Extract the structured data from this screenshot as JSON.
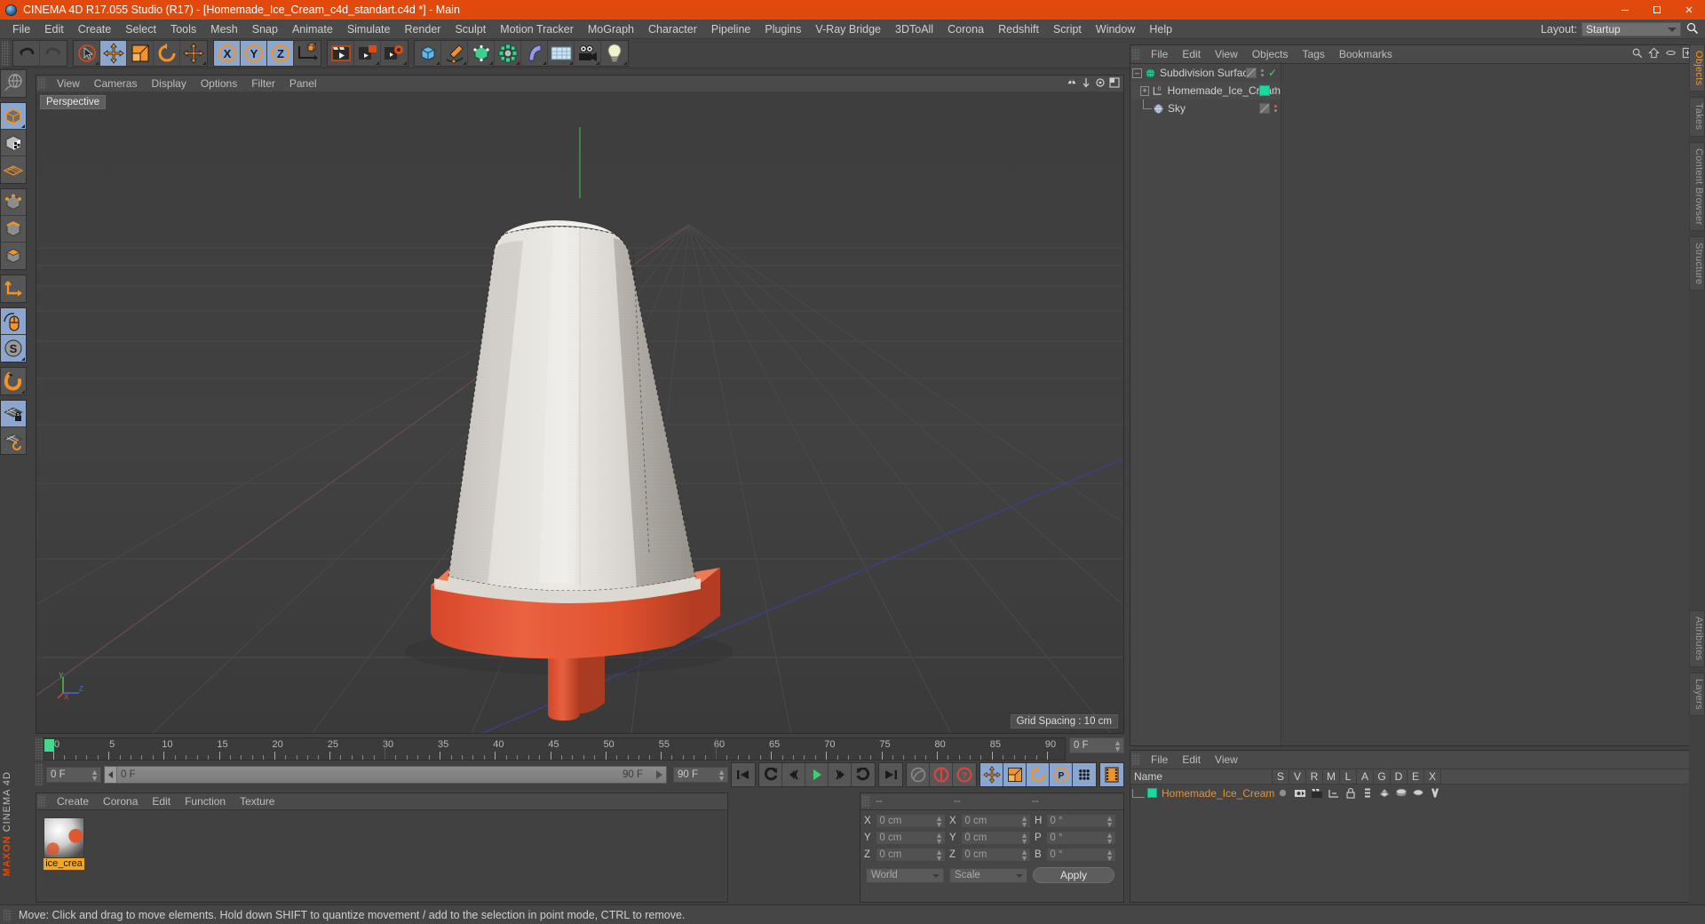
{
  "window": {
    "title": "CINEMA 4D R17.055 Studio (R17) - [Homemade_Ice_Cream_c4d_standart.c4d *] - Main",
    "minimize": "–",
    "maximize": "▢",
    "close": "✕"
  },
  "menubar": {
    "items": [
      "File",
      "Edit",
      "Create",
      "Select",
      "Tools",
      "Mesh",
      "Snap",
      "Animate",
      "Simulate",
      "Render",
      "Sculpt",
      "Motion Tracker",
      "MoGraph",
      "Character",
      "Pipeline",
      "Plugins",
      "V-Ray Bridge",
      "3DToAll",
      "Corona",
      "Redshift",
      "Script",
      "Window",
      "Help"
    ],
    "layout_label": "Layout:",
    "layout_value": "Startup"
  },
  "viewport": {
    "menu": [
      "View",
      "Cameras",
      "Display",
      "Options",
      "Filter",
      "Panel"
    ],
    "view_label": "Perspective",
    "grid_spacing": "Grid Spacing : 10 cm",
    "axis_x": "X",
    "axis_y": "Y",
    "axis_z": "Z"
  },
  "timeline": {
    "ticks": [
      0,
      5,
      10,
      15,
      20,
      25,
      30,
      35,
      40,
      45,
      50,
      55,
      60,
      65,
      70,
      75,
      80,
      85,
      90
    ],
    "current_frame_field": "0 F",
    "frame_end_field": "0 F",
    "scrub_left": "0 F",
    "scrub_right": "90 F",
    "range_end": "90 F",
    "preview_end": "90 F"
  },
  "material_manager": {
    "menu": [
      "Create",
      "Corona",
      "Edit",
      "Function",
      "Texture"
    ],
    "materials": [
      {
        "name": "ice_crea"
      }
    ]
  },
  "coordinates": {
    "header": [
      "--",
      "--",
      "--"
    ],
    "rows": [
      {
        "pos_label": "X",
        "pos_value": "0 cm",
        "size_label": "X",
        "size_value": "0 cm",
        "rot_label": "H",
        "rot_value": "0 °"
      },
      {
        "pos_label": "Y",
        "pos_value": "0 cm",
        "size_label": "Y",
        "size_value": "0 cm",
        "rot_label": "P",
        "rot_value": "0 °"
      },
      {
        "pos_label": "Z",
        "pos_value": "0 cm",
        "size_label": "Z",
        "size_value": "0 cm",
        "rot_label": "B",
        "rot_value": "0 °"
      }
    ],
    "space_select": "World",
    "mode_select": "Scale",
    "apply_label": "Apply"
  },
  "object_manager": {
    "menu": [
      "File",
      "Edit",
      "View",
      "Objects",
      "Tags",
      "Bookmarks"
    ],
    "icons": [
      "search-icon",
      "home-icon",
      "ellipse-icon",
      "expand-icon"
    ],
    "objects": [
      {
        "name": "Subdivision Surface",
        "icon": "subdivision-surface-icon",
        "enabled_check": "✓"
      },
      {
        "name": "Homemade_Ice_Cream",
        "icon": "null-object-icon"
      },
      {
        "name": "Sky",
        "icon": "sky-icon"
      }
    ]
  },
  "attribute_manager": {
    "menu": [
      "File",
      "Edit",
      "View"
    ],
    "columns": [
      "Name",
      "S",
      "V",
      "R",
      "M",
      "L",
      "A",
      "G",
      "D",
      "E",
      "X"
    ],
    "rows": [
      {
        "name": "Homemade_Ice_Cream"
      }
    ]
  },
  "side_tabs": [
    {
      "label": "Objects",
      "active": true
    },
    {
      "label": "Takes",
      "active": false
    },
    {
      "label": "Content Browser",
      "active": false
    },
    {
      "label": "Structure",
      "active": false
    }
  ],
  "left_tabs": [
    {
      "label": "Attributes"
    },
    {
      "label": "Layers"
    }
  ],
  "statusbar": {
    "message": "Move: Click and drag to move elements. Hold down SHIFT to quantize movement / add to the selection in point mode, CTRL to remove."
  },
  "brand": {
    "maxon": "MAXON",
    "cinema4d": "CINEMA 4D"
  },
  "colors": {
    "title_bar": "#e2490c",
    "accent": "#f0932b",
    "selection": "#8ba7cf",
    "panel": "#454545",
    "green": "#1bd7a0",
    "model_cream": "#d8d5d0",
    "model_red": "#e0542a"
  }
}
